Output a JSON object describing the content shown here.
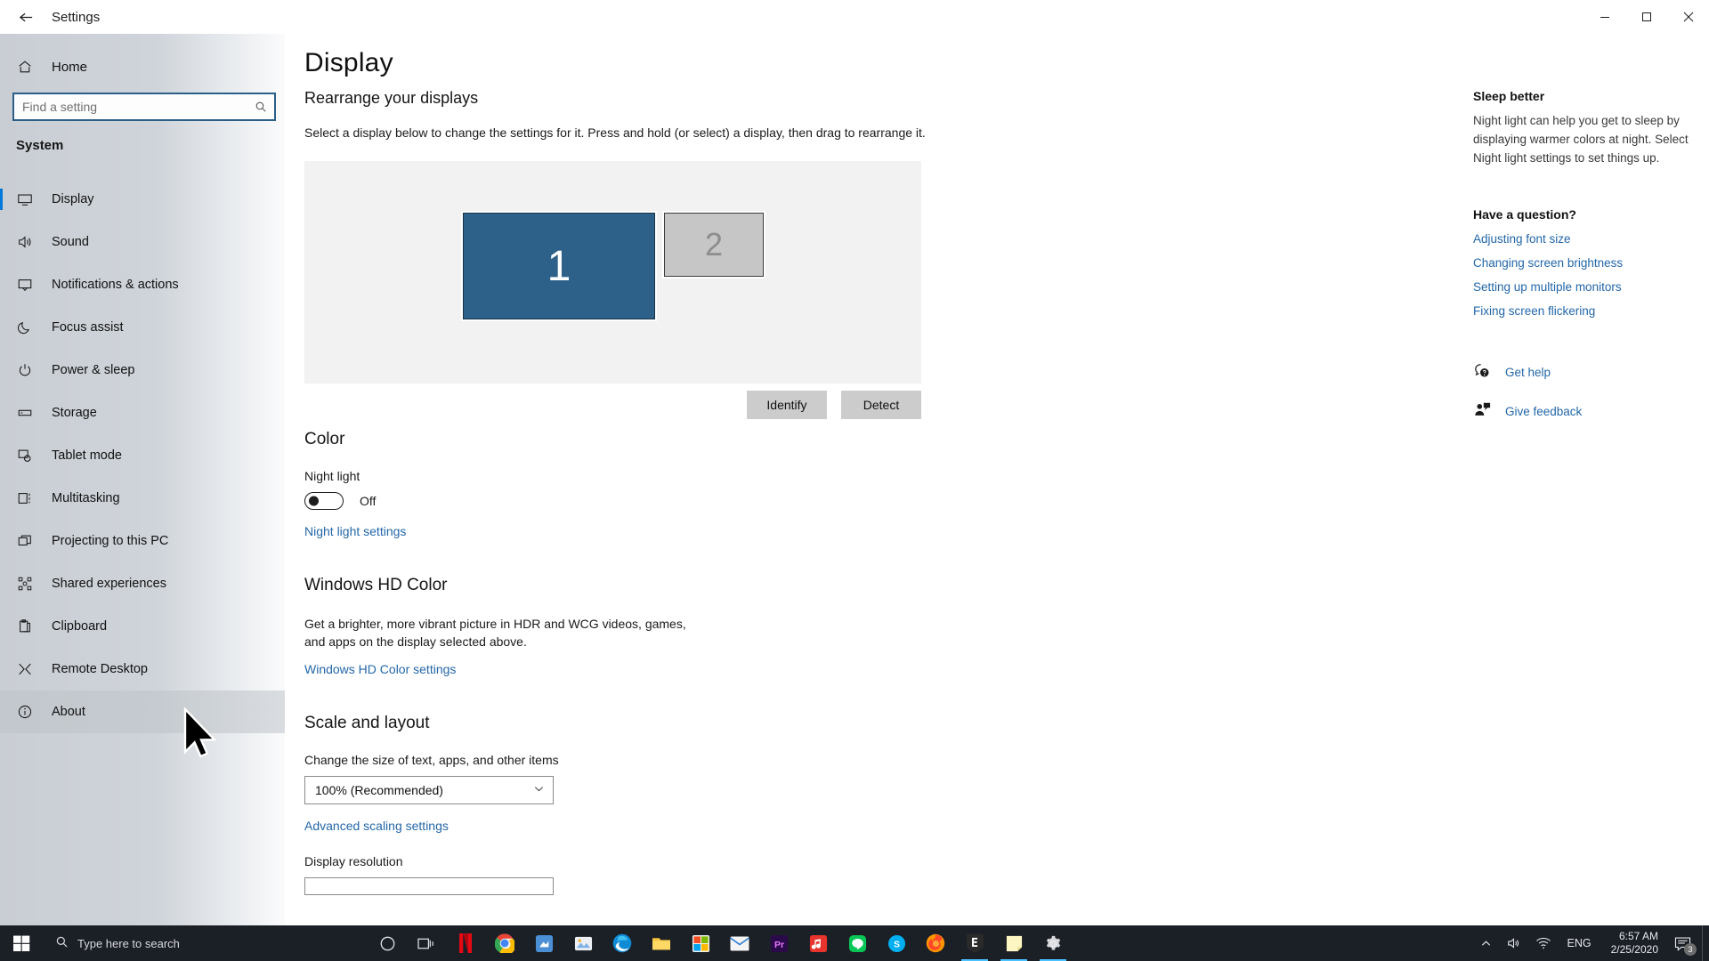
{
  "window": {
    "title": "Settings",
    "back_icon": "back-arrow-icon",
    "minimize_label": "Minimize",
    "maximize_label": "Restore",
    "close_label": "Close"
  },
  "nav": {
    "home_label": "Home",
    "home_icon": "home-icon",
    "search": {
      "placeholder": "Find a setting",
      "value": "",
      "icon": "search-icon"
    },
    "group_label": "System",
    "items": [
      {
        "label": "Display",
        "icon": "monitor-icon",
        "state": "selected"
      },
      {
        "label": "Sound",
        "icon": "speaker-icon",
        "state": "normal"
      },
      {
        "label": "Notifications & actions",
        "icon": "notification-icon",
        "state": "normal"
      },
      {
        "label": "Focus assist",
        "icon": "moon-icon",
        "state": "normal"
      },
      {
        "label": "Power & sleep",
        "icon": "power-icon",
        "state": "normal"
      },
      {
        "label": "Storage",
        "icon": "drive-icon",
        "state": "normal"
      },
      {
        "label": "Tablet mode",
        "icon": "tablet-icon",
        "state": "normal"
      },
      {
        "label": "Multitasking",
        "icon": "multitask-icon",
        "state": "normal"
      },
      {
        "label": "Projecting to this PC",
        "icon": "project-icon",
        "state": "normal"
      },
      {
        "label": "Shared experiences",
        "icon": "share-icon",
        "state": "normal"
      },
      {
        "label": "Clipboard",
        "icon": "clipboard-icon",
        "state": "normal"
      },
      {
        "label": "Remote Desktop",
        "icon": "remote-desktop-icon",
        "state": "normal"
      },
      {
        "label": "About",
        "icon": "info-icon",
        "state": "hovered"
      }
    ]
  },
  "main": {
    "page_title": "Display",
    "rearrange": {
      "heading": "Rearrange your displays",
      "description": "Select a display below to change the settings for it. Press and hold (or select) a display, then drag to rearrange it.",
      "monitors": [
        {
          "number": "1",
          "state": "selected"
        },
        {
          "number": "2",
          "state": "normal"
        }
      ],
      "identify_button": "Identify",
      "detect_button": "Detect"
    },
    "color": {
      "heading": "Color",
      "night_light_label": "Night light",
      "night_light_state": "Off",
      "night_light_on": false,
      "settings_link": "Night light settings"
    },
    "hd_color": {
      "heading": "Windows HD Color",
      "description": "Get a brighter, more vibrant picture in HDR and WCG videos, games, and apps on the display selected above.",
      "settings_link": "Windows HD Color settings"
    },
    "scale": {
      "heading": "Scale and layout",
      "size_label": "Change the size of text, apps, and other items",
      "size_value": "100% (Recommended)",
      "advanced_link": "Advanced scaling settings",
      "resolution_label": "Display resolution"
    }
  },
  "help": {
    "sleep_heading": "Sleep better",
    "sleep_text": "Night light can help you get to sleep by displaying warmer colors at night. Select Night light settings to set things up.",
    "question_heading": "Have a question?",
    "links": [
      "Adjusting font size",
      "Changing screen brightness",
      "Setting up multiple monitors",
      "Fixing screen flickering"
    ],
    "get_help": {
      "label": "Get help",
      "icon": "help-chat-icon"
    },
    "give_feedback": {
      "label": "Give feedback",
      "icon": "feedback-icon"
    }
  },
  "taskbar": {
    "start_icon": "windows-start-icon",
    "search_placeholder": "Type here to search",
    "search_icon": "search-icon",
    "apps": [
      {
        "name": "cortana-icon",
        "active": false
      },
      {
        "name": "task-view-icon",
        "active": false
      },
      {
        "name": "netflix-icon",
        "active": false
      },
      {
        "name": "google-chrome-icon",
        "active": false
      },
      {
        "name": "store-app-icon",
        "active": false
      },
      {
        "name": "photos-icon",
        "active": false
      },
      {
        "name": "microsoft-edge-icon",
        "active": false
      },
      {
        "name": "file-explorer-icon",
        "active": false
      },
      {
        "name": "microsoft-store-icon",
        "active": false
      },
      {
        "name": "mail-icon",
        "active": false
      },
      {
        "name": "adobe-premiere-icon",
        "active": false
      },
      {
        "name": "music-app-icon",
        "active": false
      },
      {
        "name": "line-app-icon",
        "active": false
      },
      {
        "name": "skype-icon",
        "active": false
      },
      {
        "name": "firefox-icon",
        "active": false
      },
      {
        "name": "epic-games-icon",
        "active": true
      },
      {
        "name": "sticky-notes-icon",
        "active": true
      },
      {
        "name": "settings-icon",
        "active": true
      }
    ],
    "tray": {
      "chevron_icon": "show-hidden-icons-icon",
      "volume_icon": "volume-icon",
      "network_icon": "wifi-icon",
      "language": "ENG",
      "time": "6:57 AM",
      "date": "2/25/2020",
      "notification_icon": "action-center-icon",
      "notification_count": "3"
    }
  },
  "colors": {
    "accent": "#0078d7",
    "link": "#2367a8",
    "monitor_selected": "#2d6189",
    "monitor_normal": "#c6c6c6",
    "taskbar": "#1b1f26",
    "search_border": "#2b5f87"
  }
}
